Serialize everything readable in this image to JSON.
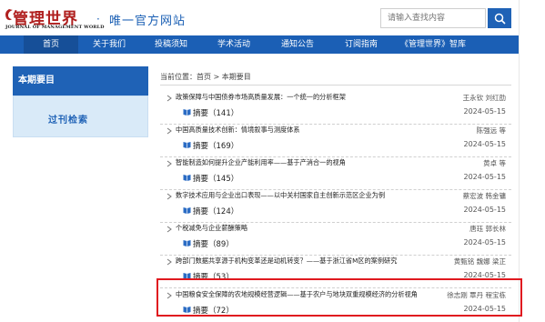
{
  "header": {
    "logo_cn": "管理世界",
    "logo_en": "JOURNAL OF MANAGEMENT WORLD",
    "site_dot": "·",
    "site_name": "唯一官方网站",
    "search_placeholder": "请输入查找内容"
  },
  "nav": {
    "items": [
      {
        "label": "首页",
        "active": true
      },
      {
        "label": "关于我们"
      },
      {
        "label": "投稿须知"
      },
      {
        "label": "学术活动"
      },
      {
        "label": "通知公告"
      },
      {
        "label": "订阅指南"
      },
      {
        "label": "《管理世界》智库"
      }
    ]
  },
  "sidebar": {
    "title": "本期要目",
    "link": "过刊检索"
  },
  "breadcrumb": {
    "prefix": "当前位置：",
    "home": "首页",
    "sep": " > ",
    "current": "本期要目"
  },
  "articles": [
    {
      "title": "政策保障与中国债券市场高质量发展：一个统一的分析框架",
      "authors": "王永钦 刘红劭",
      "abstract": "摘要（141）",
      "date": "2024-05-15"
    },
    {
      "title": "中国高质量技术创新：情境叙事与测度体系",
      "authors": "陈强远 等",
      "abstract": "摘要（169）",
      "date": "2024-05-15"
    },
    {
      "title": "智能制造如何提升企业产能利用率——基于产消合一的视角",
      "authors": "黄卓 等",
      "abstract": "摘要（145）",
      "date": "2024-05-15"
    },
    {
      "title": "数字技术应用与企业出口表现——以中关村国家自主创新示范区企业为例",
      "authors": "蔡宏波 韩金镛",
      "abstract": "摘要（124）",
      "date": "2024-05-15"
    },
    {
      "title": "个税减免与企业薪酬策略",
      "authors": "唐珏 郭长林",
      "abstract": "摘要（89）",
      "date": "2024-05-15"
    },
    {
      "title": "跨部门数据共享源于机构变革还是动机转变？——基于浙江省M区的案例研究",
      "authors": "黄甄铭 魏娜 梁正",
      "abstract": "摘要（53）",
      "date": "2024-05-15"
    },
    {
      "title": "中国粮食安全保障的农地规模经营逻辑——基于农户与地块双重规模经济的分析视角",
      "authors": "徐志刚 覃丹 程宝栋",
      "abstract": "摘要（72）",
      "date": "2024-05-15"
    }
  ],
  "colors": {
    "brand_blue": "#1b5fb5",
    "logo_red": "#b0201f",
    "highlight_red": "#e0191f",
    "sidebar_box": "#d9eaf8"
  }
}
